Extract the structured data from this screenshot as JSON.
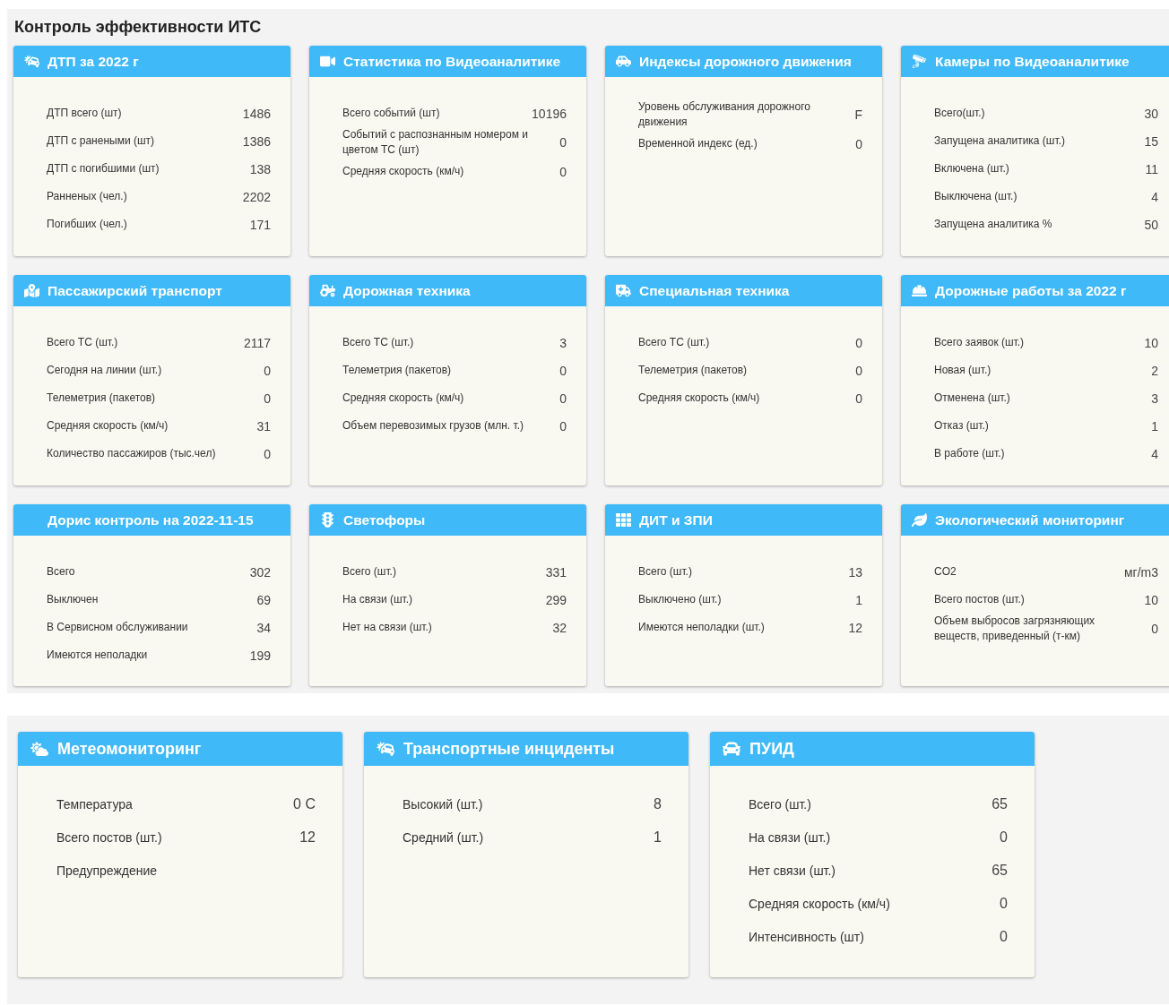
{
  "title": "Контроль эффективности ИТС",
  "cards": [
    {
      "title": "ДТП за 2022 г",
      "rows": [
        {
          "label": "ДТП всего (шт)",
          "value": "1486"
        },
        {
          "label": "ДТП с ранеными (шт)",
          "value": "1386"
        },
        {
          "label": "ДТП с погибшими (шт)",
          "value": "138"
        },
        {
          "label": "Ранненых (чел.)",
          "value": "2202"
        },
        {
          "label": "Погибших (чел.)",
          "value": "171"
        }
      ]
    },
    {
      "title": "Статистика по Видеоаналитике",
      "rows": [
        {
          "label": "Всего событий (шт)",
          "value": "10196"
        },
        {
          "label": "Событий с распознанным номером и цветом ТС (шт)",
          "value": "0"
        },
        {
          "label": "Средняя скорость (км/ч)",
          "value": "0"
        }
      ]
    },
    {
      "title": "Индексы дорожного движения",
      "rows": [
        {
          "label": "Уровень обслуживания дорожного движения",
          "value": "F"
        },
        {
          "label": "Временной индекс (ед.)",
          "value": "0"
        }
      ]
    },
    {
      "title": "Камеры по Видеоаналитике",
      "rows": [
        {
          "label": "Всего(шт.)",
          "value": "30"
        },
        {
          "label": "Запущена аналитика (шт.)",
          "value": "15"
        },
        {
          "label": "Включена (шт.)",
          "value": "11"
        },
        {
          "label": "Выключена (шт.)",
          "value": "4"
        },
        {
          "label": "Запущена аналитика %",
          "value": "50"
        }
      ]
    },
    {
      "title": "Пассажирский транспорт",
      "rows": [
        {
          "label": "Всего ТС (шт.)",
          "value": "2117"
        },
        {
          "label": "Сегодня на линии (шт.)",
          "value": "0"
        },
        {
          "label": "Телеметрия (пакетов)",
          "value": "0"
        },
        {
          "label": "Средняя скорость (км/ч)",
          "value": "31"
        },
        {
          "label": "Количество пассажиров (тыс.чел)",
          "value": "0"
        }
      ]
    },
    {
      "title": "Дорожная техника",
      "rows": [
        {
          "label": "Всего ТС (шт.)",
          "value": "3"
        },
        {
          "label": "Телеметрия (пакетов)",
          "value": "0"
        },
        {
          "label": "Средняя скорость (км/ч)",
          "value": "0"
        },
        {
          "label": "Объем перевозимых грузов (млн. т.)",
          "value": "0"
        }
      ]
    },
    {
      "title": "Специальная техника",
      "rows": [
        {
          "label": "Всего ТС (шт.)",
          "value": "0"
        },
        {
          "label": "Телеметрия (пакетов)",
          "value": "0"
        },
        {
          "label": "Средняя скорость (км/ч)",
          "value": "0"
        }
      ]
    },
    {
      "title": "Дорожные работы за 2022 г",
      "rows": [
        {
          "label": "Всего заявок (шт.)",
          "value": "10"
        },
        {
          "label": "Новая (шт.)",
          "value": "2"
        },
        {
          "label": "Отменена (шт.)",
          "value": "3"
        },
        {
          "label": "Отказ (шт.)",
          "value": "1"
        },
        {
          "label": "В работе (шт.)",
          "value": "4"
        }
      ]
    },
    {
      "title": "Дорис контроль на 2022-11-15",
      "rows": [
        {
          "label": "Всего",
          "value": "302"
        },
        {
          "label": "Выключен",
          "value": "69"
        },
        {
          "label": "В Сервисном обслуживании",
          "value": "34"
        },
        {
          "label": "Имеются неполадки",
          "value": "199"
        }
      ]
    },
    {
      "title": "Светофоры",
      "rows": [
        {
          "label": "Всего (шт.)",
          "value": "331"
        },
        {
          "label": "На связи (шт.)",
          "value": "299"
        },
        {
          "label": "Нет на связи (шт.)",
          "value": "32"
        }
      ]
    },
    {
      "title": "ДИТ и ЗПИ",
      "rows": [
        {
          "label": "Всего (шт.)",
          "value": "13"
        },
        {
          "label": "Выключено (шт.)",
          "value": "1"
        },
        {
          "label": "Имеются неполадки (шт.)",
          "value": "12"
        }
      ]
    },
    {
      "title": "Экологический мониторинг",
      "rows": [
        {
          "label": "CO2",
          "value": "мг/m3"
        },
        {
          "label": "Всего постов (шт.)",
          "value": "10"
        },
        {
          "label": "Объем выбросов загрязняющих веществ, приведенный (т-км)",
          "value": "0"
        }
      ]
    }
  ],
  "bottom_cards": [
    {
      "title": "Метеомониторинг",
      "rows": [
        {
          "label": "Температура",
          "value": "0 C"
        },
        {
          "label": "Всего постов (шт.)",
          "value": "12"
        },
        {
          "label": "Предупреждение"
        }
      ]
    },
    {
      "title": "Транспортные инциденты",
      "rows": [
        {
          "label": "Высокий (шт.)",
          "value": "8"
        },
        {
          "label": "Средний (шт.)",
          "value": "1"
        }
      ]
    },
    {
      "title": "ПУИД",
      "rows": [
        {
          "label": "Всего (шт.)",
          "value": "65"
        },
        {
          "label": "На связи (шт.)",
          "value": "0"
        },
        {
          "label": "Нет связи (шт.)",
          "value": "65"
        },
        {
          "label": "Средняя скорость (км/ч)",
          "value": "0"
        },
        {
          "label": "Интенсивность (шт)",
          "value": "0"
        }
      ]
    }
  ]
}
